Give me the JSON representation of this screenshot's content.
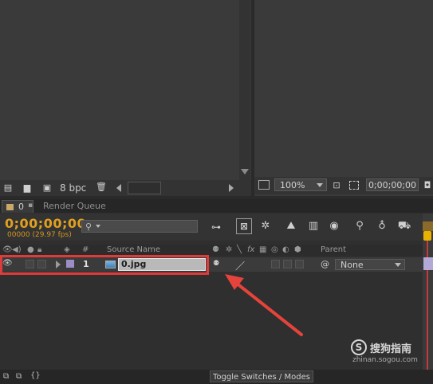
{
  "project_panel": {
    "bit_depth": "8 bpc"
  },
  "composition_viewer": {
    "zoom": "100%",
    "timecode": "0;00;00;00"
  },
  "timeline": {
    "tabs": [
      {
        "label": "0",
        "active": true
      },
      {
        "label": "Render Queue",
        "active": false
      }
    ],
    "timecode": "0;00;00;00",
    "frame_info": "00000 (29.97 fps)",
    "search_placeholder": "",
    "columns": {
      "number": "#",
      "source_name": "Source Name",
      "parent": "Parent"
    },
    "layers": [
      {
        "number": "1",
        "source_name": "0.jpg",
        "parent": "None",
        "label_color": "#9b8ec4"
      }
    ],
    "toggle_switches_label": "Toggle Switches / Modes"
  },
  "watermark": {
    "brand": "搜狗指南",
    "url": "zhinan.sogou.com"
  },
  "colors": {
    "timecode": "#e0a020",
    "highlight_box": "#e03b3b",
    "arrow": "#e5433c",
    "playhead": "#e6b400"
  }
}
